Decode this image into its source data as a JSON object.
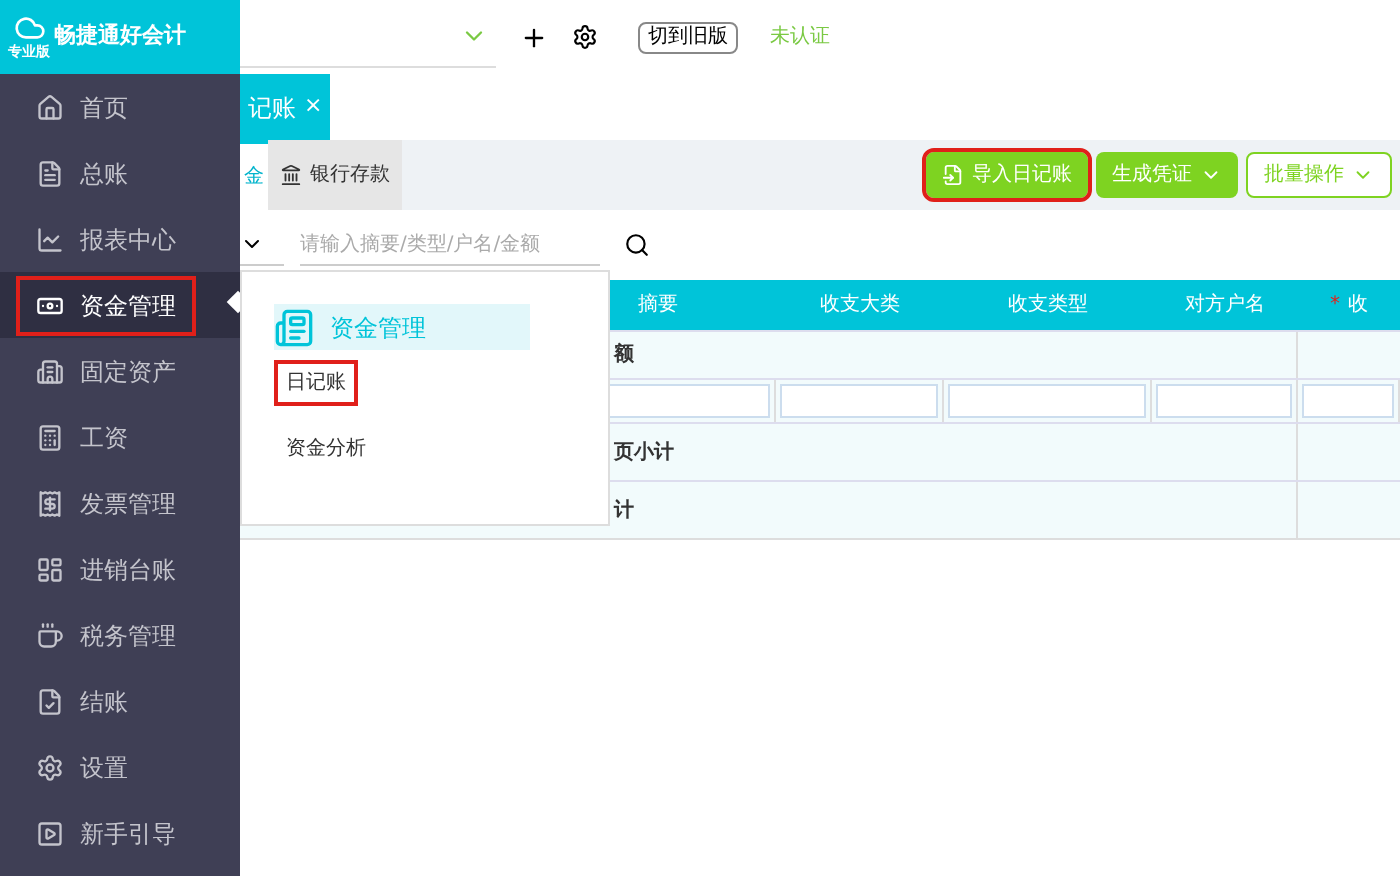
{
  "logo": {
    "name": "畅捷通好会计",
    "edition": "专业版"
  },
  "topbar": {
    "switch_button": "切到旧版",
    "auth_status": "未认证"
  },
  "sidebar": {
    "items": [
      {
        "label": "首页",
        "selected": false,
        "highlighted": false
      },
      {
        "label": "总账",
        "selected": false,
        "highlighted": false
      },
      {
        "label": "报表中心",
        "selected": false,
        "highlighted": false
      },
      {
        "label": "资金管理",
        "selected": true,
        "highlighted": true
      },
      {
        "label": "固定资产",
        "selected": false,
        "highlighted": false
      },
      {
        "label": "工资",
        "selected": false,
        "highlighted": false
      },
      {
        "label": "发票管理",
        "selected": false,
        "highlighted": false
      },
      {
        "label": "进销台账",
        "selected": false,
        "highlighted": false
      },
      {
        "label": "税务管理",
        "selected": false,
        "highlighted": false
      },
      {
        "label": "结账",
        "selected": false,
        "highlighted": false
      },
      {
        "label": "设置",
        "selected": false,
        "highlighted": false
      },
      {
        "label": "新手引导",
        "selected": false,
        "highlighted": false
      }
    ]
  },
  "tabs": [
    {
      "label": "记账",
      "close": "×",
      "selected": true
    }
  ],
  "subtabs": [
    {
      "label": "金",
      "selected": true
    },
    {
      "label": "银行存款",
      "selected": false
    }
  ],
  "actions": [
    {
      "label": "导入日记账",
      "kind": "import",
      "highlighted": true
    },
    {
      "label": "生成凭证",
      "kind": "filled-dropdown",
      "highlighted": false
    },
    {
      "label": "批量操作",
      "kind": "outline-dropdown",
      "highlighted": false
    }
  ],
  "search": {
    "placeholder": "请输入摘要/类型/户名/金额"
  },
  "table": {
    "columns": [
      {
        "label": "摘要"
      },
      {
        "label": "收支大类"
      },
      {
        "label": "收支类型"
      },
      {
        "label": "对方户名"
      },
      {
        "label": "收",
        "marker": "*"
      }
    ],
    "rows": [
      {
        "kind": "text",
        "text": "额"
      },
      {
        "kind": "filter"
      },
      {
        "kind": "text",
        "text": "页小计"
      },
      {
        "kind": "text",
        "text": "计"
      }
    ]
  },
  "popup": {
    "title": "资金管理",
    "items": [
      {
        "label": "日记账",
        "highlighted": true
      },
      {
        "label": "资金分析",
        "highlighted": false
      }
    ]
  }
}
